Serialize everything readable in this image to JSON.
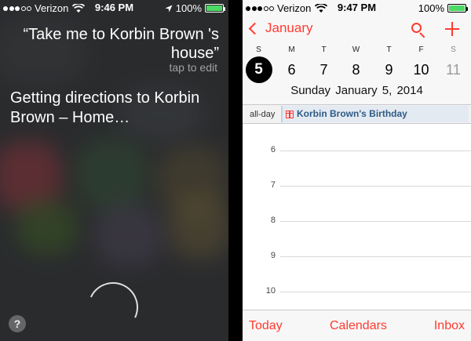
{
  "siri": {
    "status": {
      "carrier": "Verizon",
      "time": "9:46 PM",
      "battery": "100%",
      "battery_level": 1.0
    },
    "quote": "“Take me to Korbin Brown 's house”",
    "tap_to_edit": "tap to edit",
    "response": "Getting directions to Korbin Brown – Home…",
    "help": "?"
  },
  "calendar": {
    "status": {
      "carrier": "Verizon",
      "time": "9:47 PM",
      "battery": "100%",
      "battery_level": 1.0
    },
    "back_label": "January",
    "week": [
      {
        "letter": "S",
        "day": "5",
        "selected": true,
        "weekend": true
      },
      {
        "letter": "M",
        "day": "6"
      },
      {
        "letter": "T",
        "day": "7"
      },
      {
        "letter": "W",
        "day": "8"
      },
      {
        "letter": "T",
        "day": "9"
      },
      {
        "letter": "F",
        "day": "10"
      },
      {
        "letter": "S",
        "day": "11",
        "weekend": true
      }
    ],
    "date_line": "Sunday  January 5, 2014",
    "all_day_label": "all-day",
    "all_day_event": "Korbin Brown's Birthday",
    "hours": [
      "6",
      "7",
      "8",
      "9",
      "10"
    ],
    "toolbar": {
      "today": "Today",
      "calendars": "Calendars",
      "inbox": "Inbox"
    }
  },
  "colors": {
    "accent": "#ff3b30",
    "battery": "#4cd964",
    "selected_day": "#000000"
  },
  "icons": [
    "wifi-icon",
    "location-arrow-icon",
    "battery-icon",
    "chevron-left-icon",
    "search-icon",
    "plus-icon",
    "gift-icon",
    "help-icon",
    "siri-mic-icon"
  ]
}
